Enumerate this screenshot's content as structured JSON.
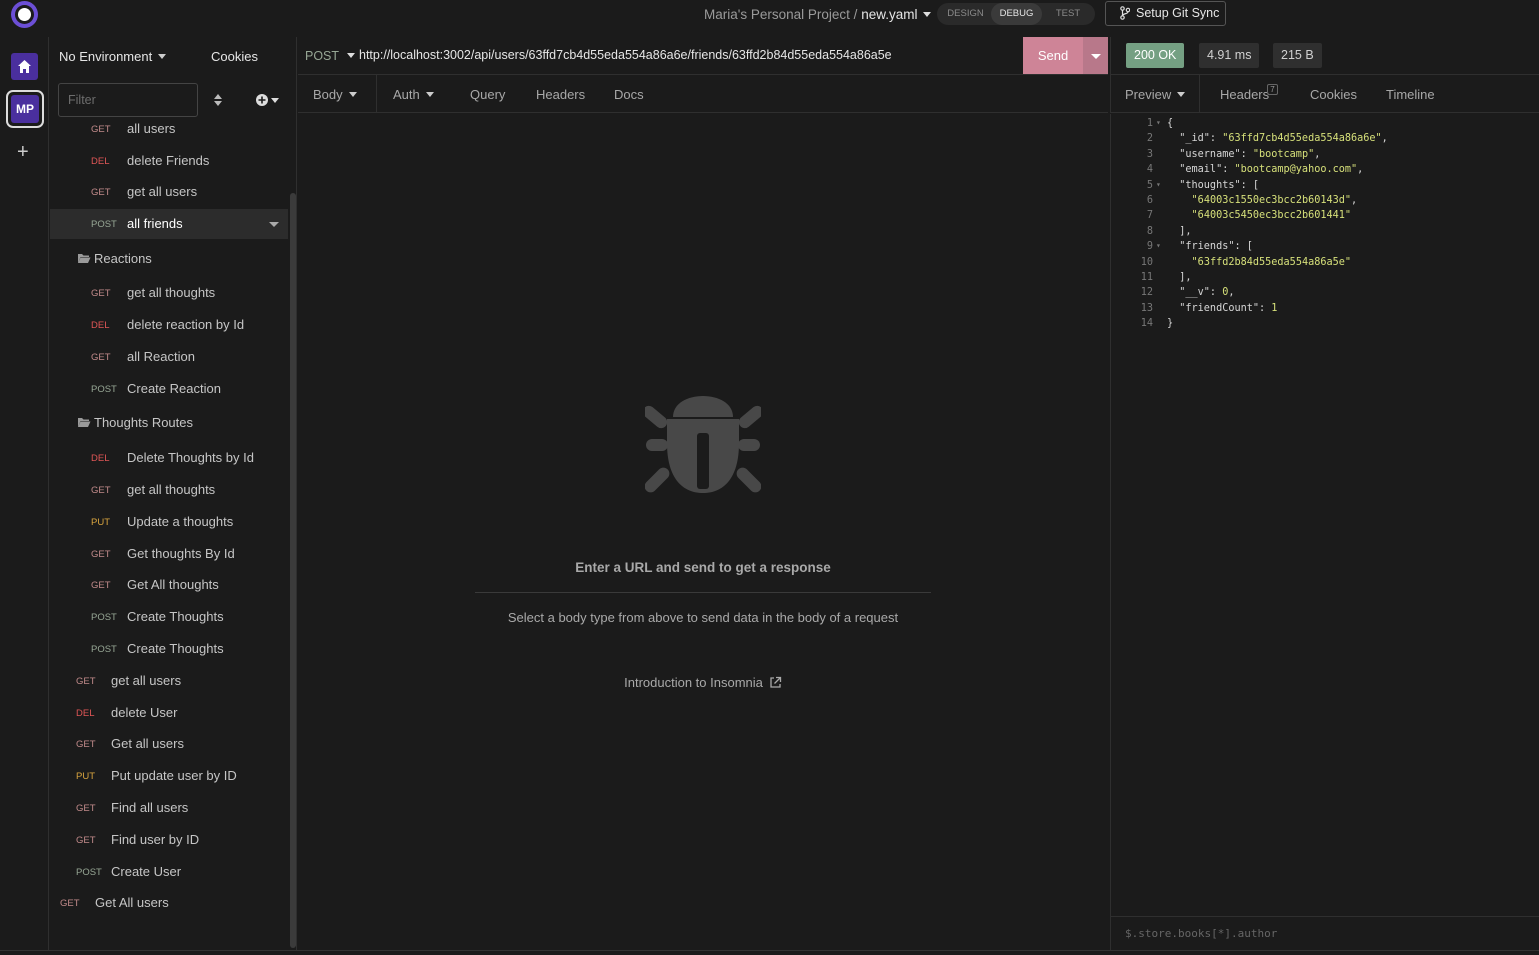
{
  "breadcrumb": {
    "project": "Maria's Personal Project",
    "separator": "/",
    "file": "new.yaml"
  },
  "modes": [
    "DESIGN",
    "DEBUG",
    "TEST"
  ],
  "active_mode": "DEBUG",
  "git_sync_label": "Setup Git Sync",
  "rail": {
    "workspace_initials": "MP",
    "add_label": "+"
  },
  "sidebar": {
    "environment": "No Environment",
    "cookies": "Cookies",
    "filter_placeholder": "Filter",
    "items": [
      {
        "type": "request",
        "method": "GET",
        "label": "all users"
      },
      {
        "type": "request",
        "method": "DEL",
        "label": "delete Friends"
      },
      {
        "type": "request",
        "method": "GET",
        "label": "get all users"
      },
      {
        "type": "request",
        "method": "POST",
        "label": "all friends",
        "active": true
      },
      {
        "type": "folder",
        "label": "Reactions"
      },
      {
        "type": "request",
        "method": "GET",
        "label": "get all thoughts"
      },
      {
        "type": "request",
        "method": "DEL",
        "label": "delete reaction by Id"
      },
      {
        "type": "request",
        "method": "GET",
        "label": "all Reaction"
      },
      {
        "type": "request",
        "method": "POST",
        "label": "Create Reaction"
      },
      {
        "type": "folder",
        "label": "Thoughts Routes"
      },
      {
        "type": "request",
        "method": "DEL",
        "label": "Delete Thoughts by Id"
      },
      {
        "type": "request",
        "method": "GET",
        "label": "get all thoughts"
      },
      {
        "type": "request",
        "method": "PUT",
        "label": "Update a thoughts"
      },
      {
        "type": "request",
        "method": "GET",
        "label": "Get thoughts By Id"
      },
      {
        "type": "request",
        "method": "GET",
        "label": "Get All thoughts"
      },
      {
        "type": "request",
        "method": "POST",
        "label": "Create Thoughts"
      },
      {
        "type": "request",
        "method": "POST",
        "label": "Create Thoughts"
      },
      {
        "type": "request",
        "method": "GET",
        "label": "get all users"
      },
      {
        "type": "request",
        "method": "DEL",
        "label": "delete User"
      },
      {
        "type": "request",
        "method": "GET",
        "label": "Get all users"
      },
      {
        "type": "request",
        "method": "PUT",
        "label": "Put update user by ID"
      },
      {
        "type": "request",
        "method": "GET",
        "label": "Find all users"
      },
      {
        "type": "request",
        "method": "GET",
        "label": "Find user by ID"
      },
      {
        "type": "request",
        "method": "POST",
        "label": "Create User"
      },
      {
        "type": "request",
        "method": "GET",
        "label": "Get All users"
      }
    ]
  },
  "request": {
    "method": "POST",
    "url": "http://localhost:3002/api/users/63ffd7cb4d55eda554a86a6e/friends/63ffd2b84d55eda554a86a5e",
    "send_label": "Send",
    "tabs": [
      "Body",
      "Auth",
      "Query",
      "Headers",
      "Docs"
    ],
    "empty_title": "Enter a URL and send to get a response",
    "empty_subtitle": "Select a body type from above to send data in the body of a request",
    "intro_link": "Introduction to Insomnia"
  },
  "response": {
    "status": "200 OK",
    "time": "4.91 ms",
    "size": "215 B",
    "tabs": [
      "Preview",
      "Headers",
      "Cookies",
      "Timeline"
    ],
    "headers_count": "7",
    "body_lines": [
      "{",
      "  \"_id\": \"63ffd7cb4d55eda554a86a6e\",",
      "  \"username\": \"bootcamp\",",
      "  \"email\": \"bootcamp@yahoo.com\",",
      "  \"thoughts\": [",
      "    \"64003c1550ec3bcc2b60143d\",",
      "    \"64003c5450ec3bcc2b601441\"",
      "  ],",
      "  \"friends\": [",
      "    \"63ffd2b84d55eda554a86a5e\"",
      "  ],",
      "  \"__v\": 0,",
      "  \"friendCount\": 1",
      "}"
    ],
    "filter_placeholder": "$.store.books[*].author"
  },
  "colors": {
    "accent": "#4a2f9e",
    "send": "#ce8497",
    "status_ok": "#75a083",
    "method_get": "#c28b8b",
    "method_post": "#97a795",
    "method_put": "#d8a43f",
    "method_del": "#e05656"
  }
}
